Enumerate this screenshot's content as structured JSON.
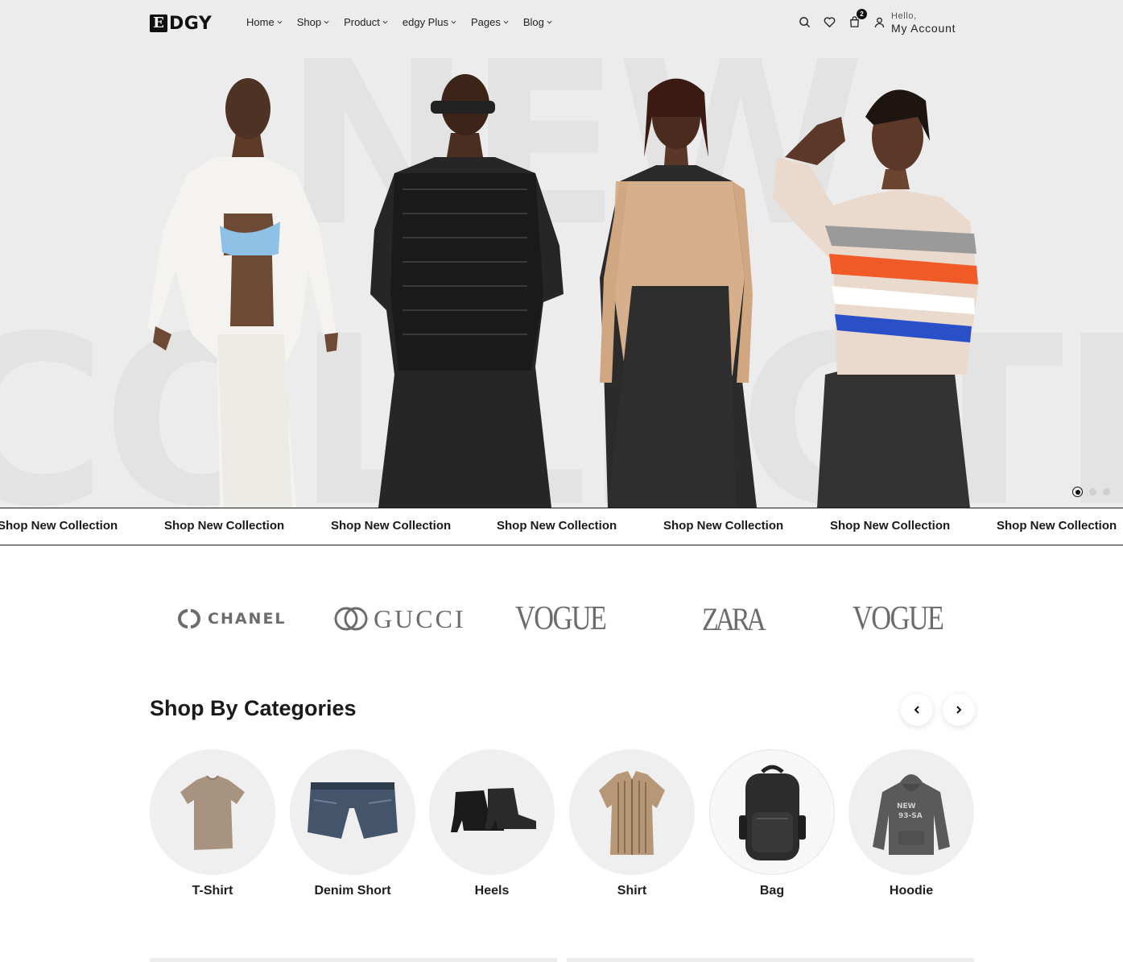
{
  "brand": {
    "logo_letter": "E",
    "logo_text": "DGY"
  },
  "nav": {
    "items": [
      {
        "label": "Home"
      },
      {
        "label": "Shop"
      },
      {
        "label": "Product"
      },
      {
        "label": "edgy Plus"
      },
      {
        "label": "Pages"
      },
      {
        "label": "Blog"
      }
    ]
  },
  "header_icons": {
    "search": "search-icon",
    "wishlist": "heart-icon",
    "cart": "cart-icon",
    "cart_count": "2",
    "account": "user-icon"
  },
  "account": {
    "greeting": "Hello,",
    "label": "My Account"
  },
  "hero": {
    "background_words": [
      "NEW",
      "COLLECTION"
    ],
    "slides_total": 3,
    "active_slide": 1
  },
  "marquee": {
    "items": [
      "Shop New Collection",
      "Shop New Collection",
      "Shop New Collection",
      "Shop New Collection",
      "Shop New Collection",
      "Shop New Collection",
      "Shop New Collection"
    ]
  },
  "brands": [
    "CHANEL",
    "GUCCI",
    "VOGUE",
    "ZARA",
    "VOGUE"
  ],
  "categories": {
    "title": "Shop By Categories",
    "items": [
      {
        "label": "T-Shirt"
      },
      {
        "label": "Denim Short"
      },
      {
        "label": "Heels"
      },
      {
        "label": "Shirt"
      },
      {
        "label": "Bag"
      },
      {
        "label": "Hoodie"
      }
    ]
  },
  "colors": {
    "accent": "#111111",
    "hero_bg": "#ececec",
    "text": "#1e1e1e"
  }
}
